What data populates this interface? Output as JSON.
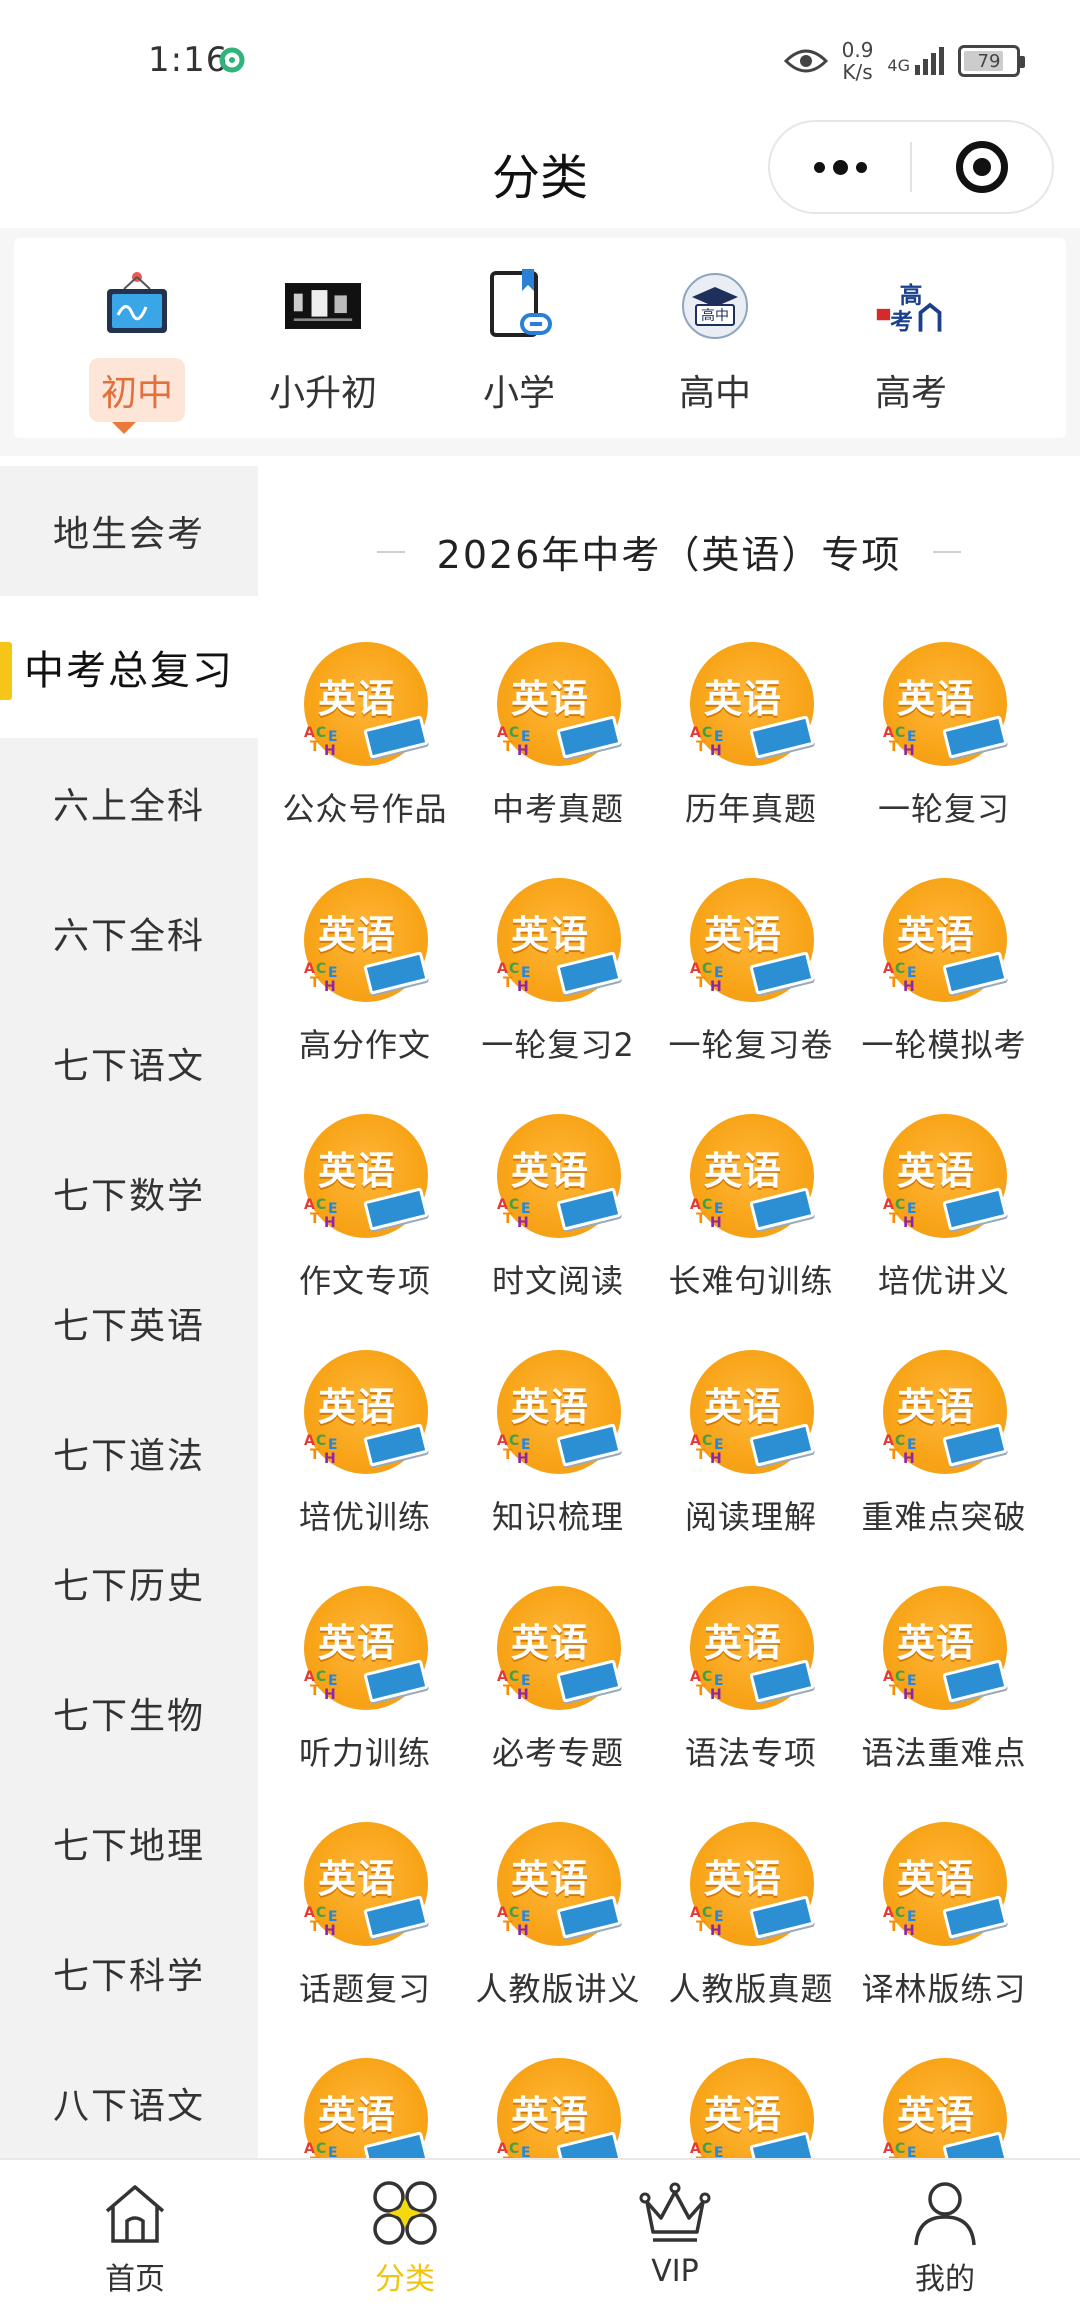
{
  "status_bar": {
    "time": "1:16",
    "net_speed_value": "0.9",
    "net_speed_unit": "K/s",
    "network": "4G",
    "battery": "79"
  },
  "header": {
    "title": "分类"
  },
  "levels": [
    {
      "label": "初中",
      "icon": "whiteboard-icon",
      "active": true
    },
    {
      "label": "小升初",
      "icon": "banner-image-icon",
      "active": false
    },
    {
      "label": "小学",
      "icon": "notebook-icon",
      "active": false
    },
    {
      "label": "高中",
      "icon": "graduation-cap-icon",
      "active": false
    },
    {
      "label": "高考",
      "icon": "gaokao-logo-icon",
      "active": false
    }
  ],
  "sidebar": {
    "items": [
      {
        "label": "地生会考",
        "active": false
      },
      {
        "label": "中考总复习",
        "active": true
      },
      {
        "label": "六上全科",
        "active": false
      },
      {
        "label": "六下全科",
        "active": false
      },
      {
        "label": "七下语文",
        "active": false
      },
      {
        "label": "七下数学",
        "active": false
      },
      {
        "label": "七下英语",
        "active": false
      },
      {
        "label": "七下道法",
        "active": false
      },
      {
        "label": "七下历史",
        "active": false
      },
      {
        "label": "七下生物",
        "active": false
      },
      {
        "label": "七下地理",
        "active": false
      },
      {
        "label": "七下科学",
        "active": false
      },
      {
        "label": "八下语文",
        "active": false
      }
    ]
  },
  "content": {
    "section_title": "2026年中考（英语）专项",
    "thumb_word": "英语",
    "items": [
      "公众号作品",
      "中考真题",
      "历年真题",
      "一轮复习",
      "高分作文",
      "一轮复习2",
      "一轮复习卷",
      "一轮模拟考",
      "作文专项",
      "时文阅读",
      "长难句训练",
      "培优讲义",
      "培优训练",
      "知识梳理",
      "阅读理解",
      "重难点突破",
      "听力训练",
      "必考专题",
      "语法专项",
      "语法重难点",
      "话题复习",
      "人教版讲义",
      "人教版真题",
      "译林版练习",
      "",
      "",
      "",
      ""
    ]
  },
  "bottom_nav": [
    {
      "label": "首页",
      "icon": "home-icon",
      "active": false
    },
    {
      "label": "分类",
      "icon": "category-icon",
      "active": true
    },
    {
      "label": "VIP",
      "icon": "crown-icon",
      "active": false
    },
    {
      "label": "我的",
      "icon": "user-icon",
      "active": false
    }
  ],
  "colors": {
    "accent_yellow": "#f5c518",
    "active_tab_bg": "#fde5d8",
    "active_tab_text": "#e0703c",
    "thumb_orange": "#f8a418"
  }
}
